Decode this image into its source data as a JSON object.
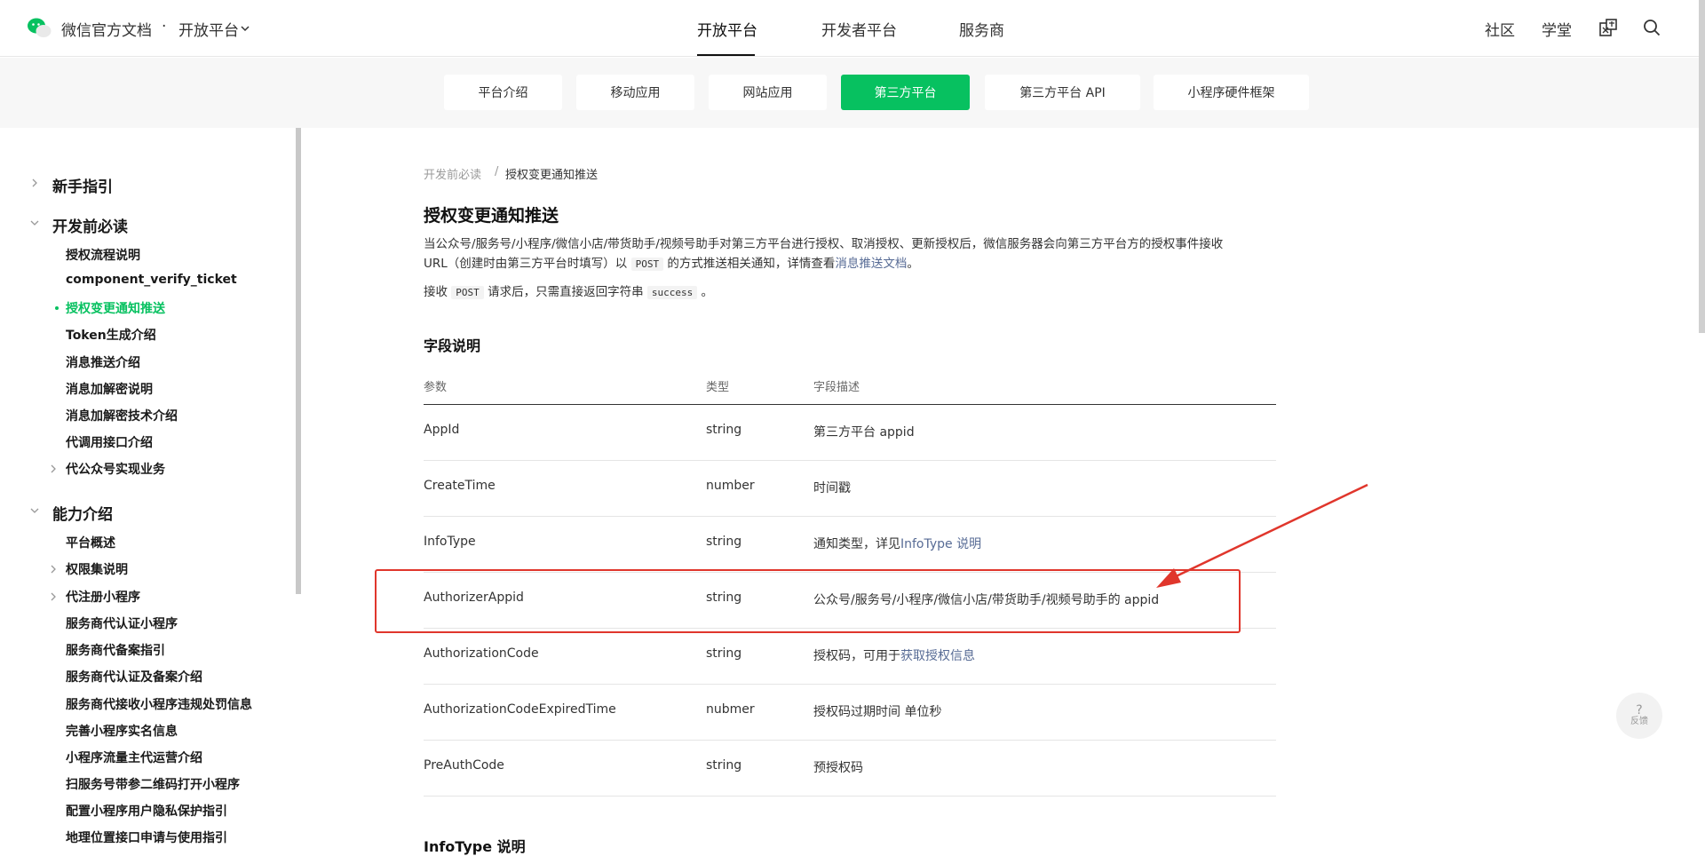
{
  "header": {
    "brand": "微信官方文档",
    "separator": "·",
    "platform": "开放平台",
    "nav": [
      "开放平台",
      "开发者平台",
      "服务商"
    ],
    "right": [
      "社区",
      "学堂"
    ],
    "icons": [
      "translate-icon",
      "search-icon"
    ]
  },
  "subnav": {
    "tabs": [
      "平台介绍",
      "移动应用",
      "网站应用",
      "第三方平台",
      "第三方平台 API",
      "小程序硬件框架"
    ],
    "active": "第三方平台",
    "accent": "#07c160"
  },
  "sidebar": {
    "sections": [
      {
        "label": "新手指引"
      },
      {
        "label": "开发前必读"
      },
      {
        "label": "能力介绍"
      }
    ],
    "items": [
      "授权流程说明",
      "component_verify_ticket",
      "授权变更通知推送",
      "Token生成介绍",
      "消息推送介绍",
      "消息加解密说明",
      "消息加解密技术介绍",
      "代调用接口介绍",
      "代公众号实现业务",
      "平台概述",
      "权限集说明",
      "代注册小程序",
      "服务商代认证小程序",
      "服务商代备案指引",
      "服务商代认证及备案介绍",
      "服务商代接收小程序违规处罚信息",
      "完善小程序实名信息",
      "小程序流量主代运营介绍",
      "扫服务号带参二维码打开小程序",
      "配置小程序用户隐私保护指引",
      "地理位置接口申请与使用指引"
    ],
    "active": "授权变更通知推送"
  },
  "content": {
    "breadcrumb": [
      "开发前必读",
      "授权变更通知推送"
    ],
    "breadcrumb_sep": "/",
    "title": "授权变更通知推送",
    "para1_a": "当公众号/服务号/小程序/微信小店/带货助手/视频号助手对第三方平台进行授权、取消授权、更新授权后，微信服务器会向第三方平台方的授权事件接收",
    "para1_b": "URL（创建时由第三方平台时填写）以 ",
    "para1_code": "POST",
    "para1_c": " 的方式推送相关通知，详情查看",
    "para1_link": "消息推送文档",
    "para1_end": "。",
    "para2_a": "接收 ",
    "para2_code": "POST",
    "para2_b": " 请求后，只需直接返回字符串 ",
    "para2_code2": "success",
    "para2_end": " 。",
    "fields_title": "字段说明",
    "table_headers": [
      "参数",
      "类型",
      "字段描述"
    ],
    "rows": [
      {
        "param": "AppId",
        "type": "string",
        "desc": "第三方平台 appid",
        "link": ""
      },
      {
        "param": "CreateTime",
        "type": "number",
        "desc": "时间戳",
        "link": ""
      },
      {
        "param": "InfoType",
        "type": "string",
        "desc": "通知类型，详见",
        "link": "InfoType 说明"
      },
      {
        "param": "AuthorizerAppid",
        "type": "string",
        "desc": "公众号/服务号/小程序/微信小店/带货助手/视频号助手的 appid",
        "link": ""
      },
      {
        "param": "AuthorizationCode",
        "type": "string",
        "desc": "授权码，可用于",
        "link": "获取授权信息"
      },
      {
        "param": "AuthorizationCodeExpiredTime",
        "type": "nubmer",
        "desc": "授权码过期时间 单位秒",
        "link": ""
      },
      {
        "param": "PreAuthCode",
        "type": "string",
        "desc": "",
        "link": "预授权码"
      }
    ],
    "next_title": "InfoType 说明"
  },
  "feedback": {
    "icon": "?",
    "label": "反馈"
  },
  "annotation": {
    "color": "#e0362c",
    "highlighted_row": "AuthorizerAppid"
  }
}
